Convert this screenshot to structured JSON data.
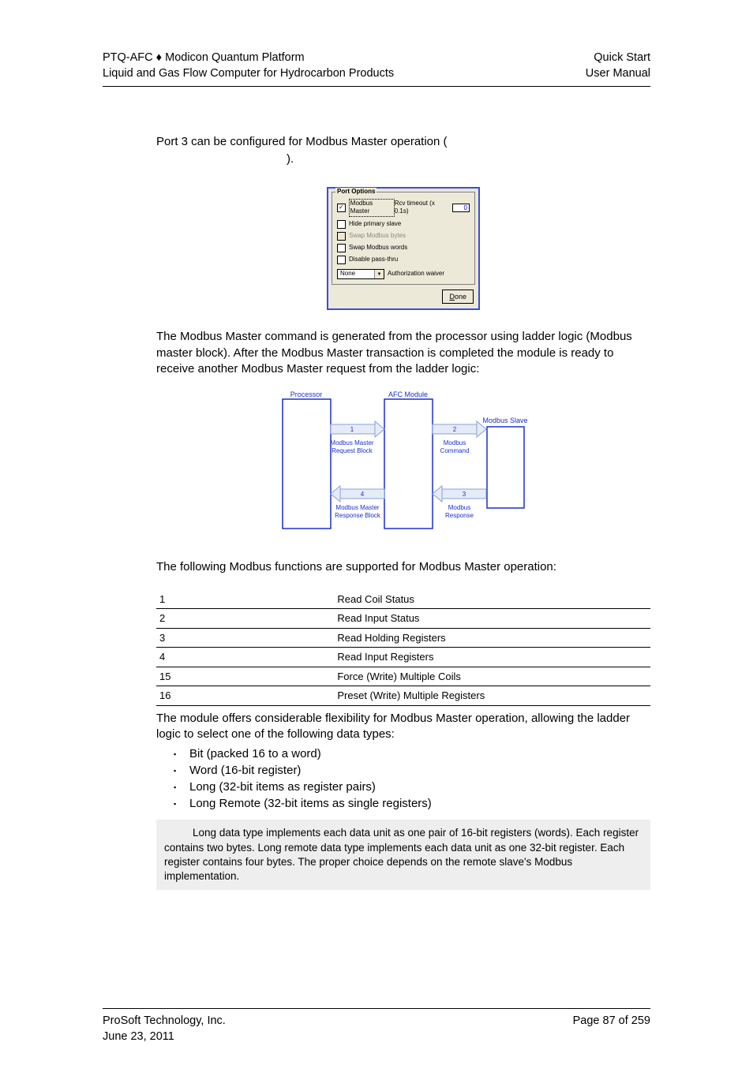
{
  "header": {
    "left_line1_a": "PTQ-AFC",
    "left_line1_sep": "♦",
    "left_line1_b": "Modicon Quantum Platform",
    "left_line2": "Liquid and Gas Flow Computer for Hydrocarbon Products",
    "right_line1": "Quick Start",
    "right_line2": "User Manual"
  },
  "body": {
    "p1a": "Port 3 can be configured for Modbus Master operation (",
    "p1b": ").",
    "p2": "The Modbus Master command is generated from the processor using ladder logic (Modbus master block). After the Modbus Master transaction is completed the module is ready to receive another Modbus Master request from the ladder logic:",
    "p3": "The following Modbus functions are supported for Modbus Master operation:",
    "p4": "The module offers considerable flexibility for Modbus Master operation, allowing the ladder logic to select one of the following data types:",
    "bullets": [
      "Bit (packed 16 to a word)",
      "Word (16-bit register)",
      "Long (32-bit items as register pairs)",
      "Long Remote (32-bit items as single registers)"
    ],
    "note": "Long data type implements each data unit as one pair of 16-bit registers (words). Each register contains two bytes. Long remote data type implements each data unit as one 32-bit register. Each register contains four bytes. The proper choice depends on the remote slave's Modbus implementation."
  },
  "port_options": {
    "legend": "Port Options",
    "opt_master": "Modbus Master",
    "rcv_label": "Rcv timeout (x 0.1s)",
    "rcv_value": "0",
    "opt_hide": "Hide primary slave",
    "opt_swap_bytes": "Swap Modbus bytes",
    "opt_swap_words": "Swap Modbus words",
    "opt_disable": "Disable pass-thru",
    "select_value": "None",
    "select_label": "Authorization waiver",
    "done_u": "D",
    "done_rest": "one"
  },
  "diagram": {
    "processor": "Processor",
    "afc": "AFC Module",
    "slave": "Modbus Slave",
    "req_block_l1": "Modbus Master",
    "req_block_l2": "Request Block",
    "resp_block_l1": "Modbus Master",
    "resp_block_l2": "Response Block",
    "cmd_l1": "Modbus",
    "cmd_l2": "Command",
    "resp_l1": "Modbus",
    "resp_l2": "Response",
    "n1": "1",
    "n2": "2",
    "n3": "3",
    "n4": "4"
  },
  "table": {
    "rows": [
      {
        "code": "1",
        "desc": "Read Coil Status"
      },
      {
        "code": "2",
        "desc": "Read Input Status"
      },
      {
        "code": "3",
        "desc": "Read Holding Registers"
      },
      {
        "code": "4",
        "desc": "Read Input Registers"
      },
      {
        "code": "15",
        "desc": "Force (Write) Multiple Coils"
      },
      {
        "code": "16",
        "desc": "Preset (Write) Multiple Registers"
      }
    ]
  },
  "footer": {
    "left_line1": "ProSoft Technology, Inc.",
    "left_line2": "June 23, 2011",
    "right_line1": "Page 87 of 259"
  }
}
